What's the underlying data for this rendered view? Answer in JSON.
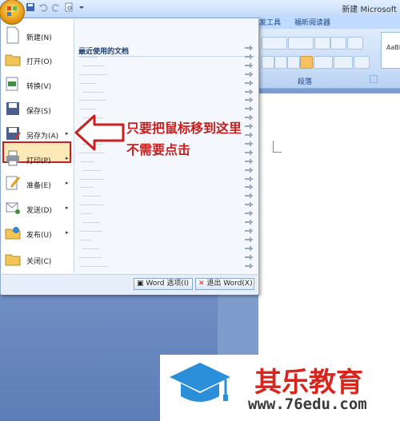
{
  "window": {
    "title": "新建 Microsoft"
  },
  "ribbon": {
    "tabs": [
      "发工具",
      "福昕阅读器"
    ],
    "paragraph_group": "段落",
    "styles_preview": "AaBl"
  },
  "office_menu": {
    "items": [
      {
        "label": "新建(N)",
        "icon": "new-document-icon",
        "submenu": false
      },
      {
        "label": "打开(O)",
        "icon": "open-folder-icon",
        "submenu": false
      },
      {
        "label": "转换(V)",
        "icon": "convert-icon",
        "submenu": false
      },
      {
        "label": "保存(S)",
        "icon": "save-disk-icon",
        "submenu": false
      },
      {
        "label": "另存为(A)",
        "icon": "save-as-icon",
        "submenu": true,
        "highlighted": true
      },
      {
        "label": "打印(P)",
        "icon": "printer-icon",
        "submenu": true
      },
      {
        "label": "准备(E)",
        "icon": "prepare-icon",
        "submenu": true
      },
      {
        "label": "发送(D)",
        "icon": "send-icon",
        "submenu": true
      },
      {
        "label": "发布(U)",
        "icon": "publish-icon",
        "submenu": true
      },
      {
        "label": "关闭(C)",
        "icon": "close-folder-icon",
        "submenu": false
      }
    ],
    "recent_title": "最近使用的文档",
    "word_options_label": "Word 选项(I)",
    "exit_word_label": "退出 Word(X)"
  },
  "annotation": {
    "line1": "只要把鼠标移到这里",
    "line2": "不需要点击",
    "color": "#c8201f"
  },
  "watermark": {
    "name": "其乐教育",
    "url": "www.76edu.com",
    "name_color": "#d9251c",
    "cap_color": "#2a8fd8"
  }
}
